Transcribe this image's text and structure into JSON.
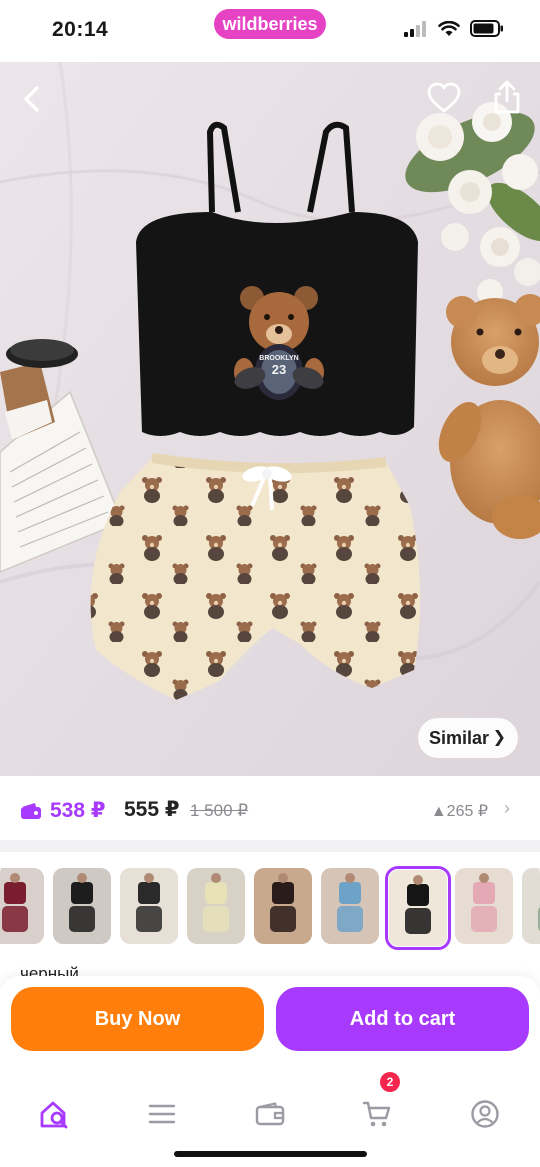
{
  "status": {
    "time": "20:14",
    "brand": "wildberries"
  },
  "hero": {
    "similar_label": "Similar",
    "print_text": "BROOKLYN",
    "print_number": "23"
  },
  "price": {
    "wallet_price": "538 ₽",
    "price": "555 ₽",
    "old_price": "1 500 ₽",
    "delta": "▲265 ₽"
  },
  "variants": {
    "thumb_count": 9,
    "selected_index": 6,
    "color_label": "черный"
  },
  "actions": {
    "buy_now": "Buy Now",
    "add_to_cart": "Add to cart"
  },
  "tabs": {
    "cart_badge": "2"
  },
  "colors": {
    "accent": "#a73afd",
    "brand_pink": "#e543c4",
    "buy_orange": "#ff7e0c",
    "badge_red": "#f5264d"
  },
  "icons": [
    "signal-icon",
    "wifi-icon",
    "battery-icon",
    "back-icon",
    "heart-icon",
    "share-icon",
    "wallet-icon",
    "chevron-right-icon",
    "home-search-icon",
    "catalog-icon",
    "wallet-tab-icon",
    "cart-icon",
    "profile-icon"
  ]
}
